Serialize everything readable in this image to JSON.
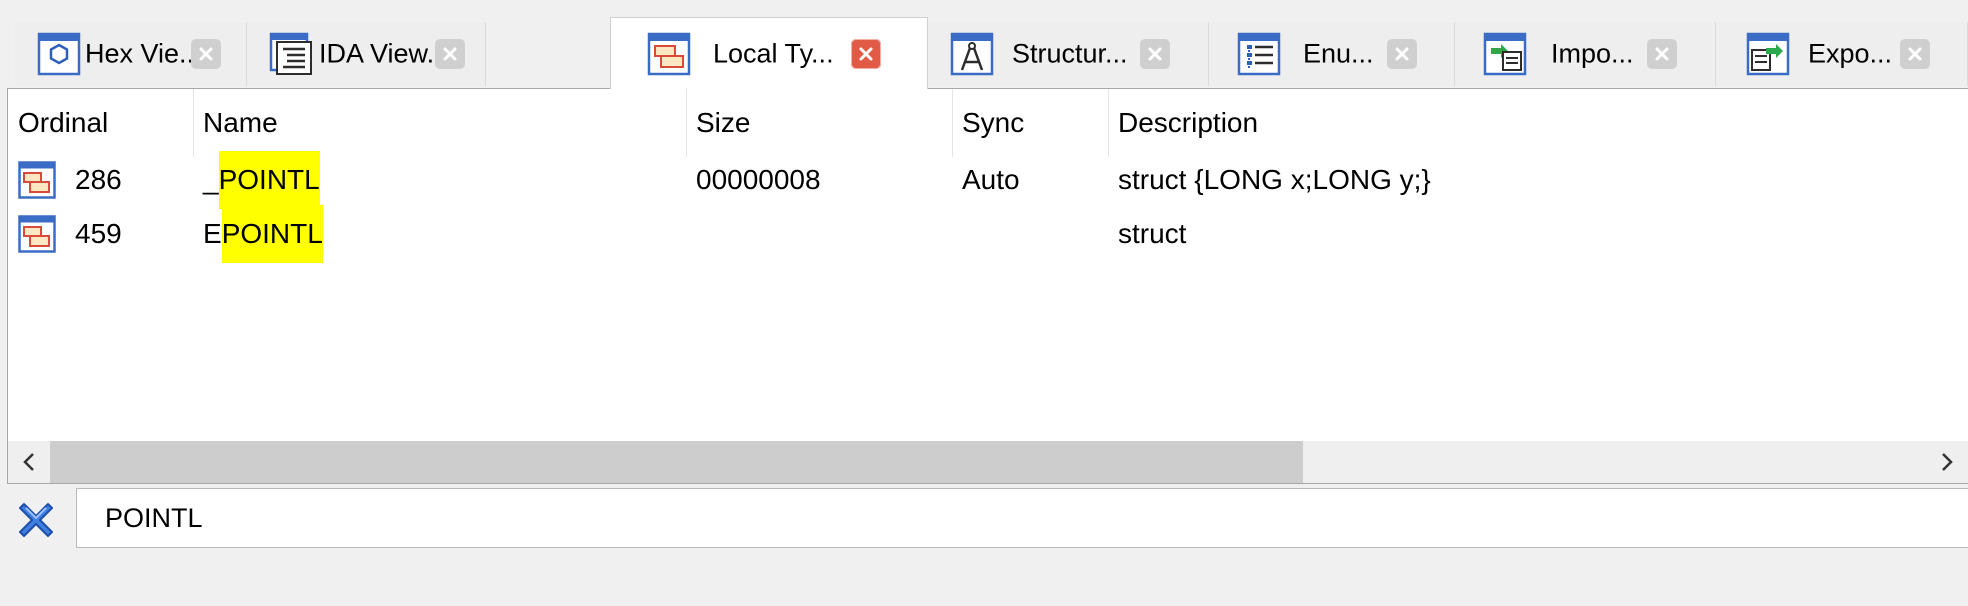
{
  "tabs": [
    {
      "label": "Hex Vie...",
      "icon": "hex-view-icon",
      "active": false
    },
    {
      "label": "IDA View...",
      "icon": "ida-view-icon",
      "active": false
    },
    {
      "label": "Local Ty...",
      "icon": "local-types-icon",
      "active": true
    },
    {
      "label": "Structur...",
      "icon": "structures-icon",
      "active": false
    },
    {
      "label": "Enu...",
      "icon": "enums-icon",
      "active": false
    },
    {
      "label": "Impo...",
      "icon": "imports-icon",
      "active": false
    },
    {
      "label": "Expo...",
      "icon": "exports-icon",
      "active": false
    }
  ],
  "table": {
    "columns": [
      "Ordinal",
      "Name",
      "Size",
      "Sync",
      "Description"
    ],
    "rows": [
      {
        "ordinal": "286",
        "name_prefix": "_",
        "name_match": "POINTL",
        "size": "00000008",
        "sync": "Auto",
        "description": "struct {LONG x;LONG y;}"
      },
      {
        "ordinal": "459",
        "name_prefix": "E",
        "name_match": "POINTL",
        "size": "",
        "sync": "",
        "description": "struct"
      }
    ]
  },
  "filter": {
    "value": "POINTL",
    "clear_icon": "clear-filter-icon"
  },
  "colors": {
    "highlight": "#ffff00",
    "close_active": "#e05a45",
    "close_inactive": "#cfcfcf"
  }
}
